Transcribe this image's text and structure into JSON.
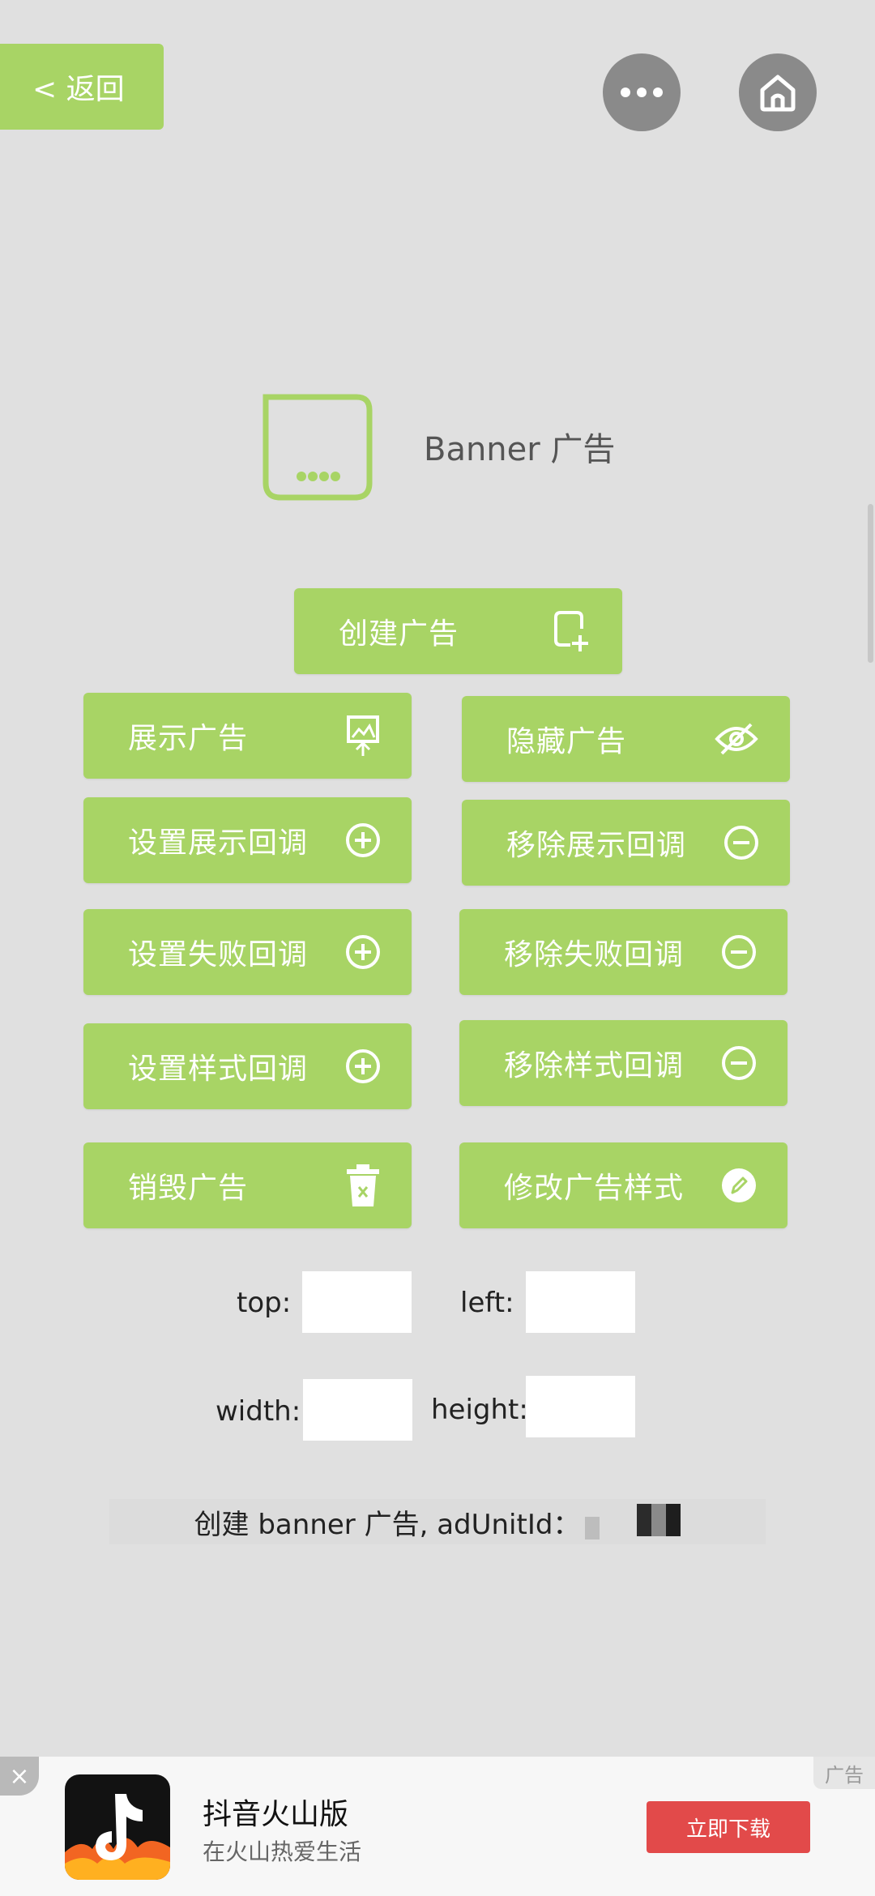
{
  "nav": {
    "back_label": "< 返回"
  },
  "header": {
    "title": "Banner 广告"
  },
  "buttons": {
    "create": "创建广告",
    "show": "展示广告",
    "hide": "隐藏广告",
    "set_show_cb": "设置展示回调",
    "remove_show_cb": "移除展示回调",
    "set_fail_cb": "设置失败回调",
    "remove_fail_cb": "移除失败回调",
    "set_style_cb": "设置样式回调",
    "remove_style_cb": "移除样式回调",
    "destroy": "销毁广告",
    "modify_style": "修改广告样式"
  },
  "style_fields": {
    "top_label": "top:",
    "left_label": "left:",
    "width_label": "width:",
    "height_label": "height:",
    "top_value": "",
    "left_value": "",
    "width_value": "",
    "height_value": ""
  },
  "note": {
    "text": "创建 banner 广告, adUnitId："
  },
  "ad": {
    "tag": "广告",
    "close": "×",
    "app_name": "抖音火山版",
    "app_desc": "在火山热爱生活",
    "download_label": "立即下载"
  },
  "colors": {
    "accent": "#a8d465",
    "download": "#e24a4a",
    "background": "#e0e0e0"
  }
}
